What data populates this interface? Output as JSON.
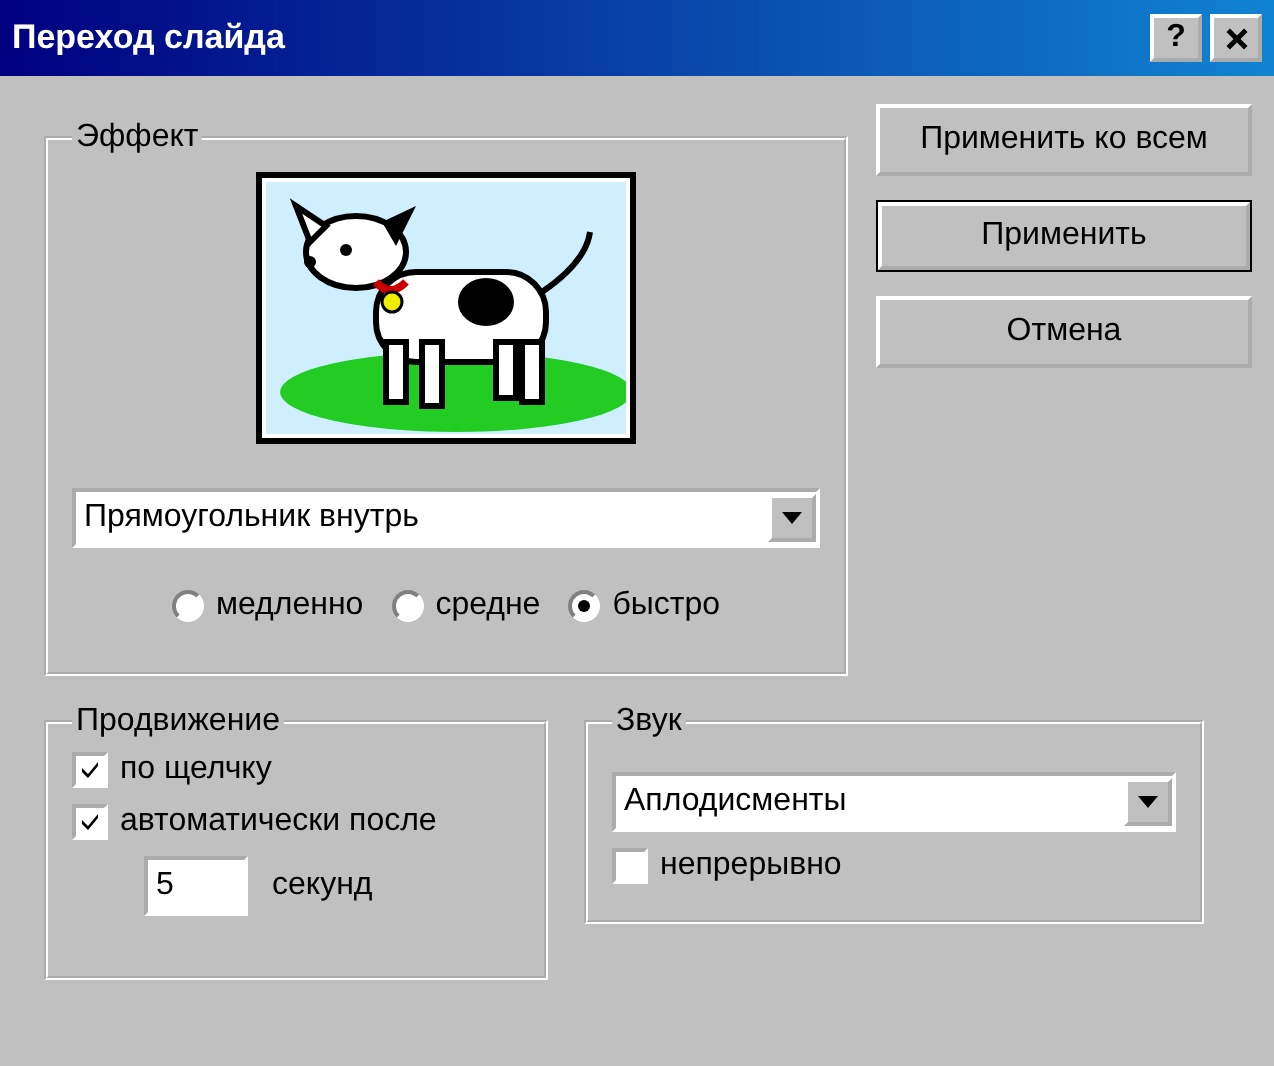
{
  "window": {
    "title": "Переход слайда",
    "help": "?"
  },
  "effect": {
    "label": "Эффект",
    "transition": "Прямоугольник внутрь",
    "speeds": [
      {
        "label": "медленно",
        "selected": false
      },
      {
        "label": "средне",
        "selected": false
      },
      {
        "label": "быстро",
        "selected": true
      }
    ]
  },
  "buttons": [
    {
      "label": "Применить ко всем",
      "default": false
    },
    {
      "label": "Применить",
      "default": true
    },
    {
      "label": "Отмена",
      "default": false
    }
  ],
  "advance": {
    "label": "Продвижение",
    "options": [
      {
        "label": "по щелчку",
        "checked": true
      },
      {
        "label": "автоматически после",
        "checked": true
      }
    ],
    "seconds": "5",
    "unit": "секунд"
  },
  "sound": {
    "label": "Звук",
    "value": "Аплодисменты",
    "loop": {
      "label": "непрерывно",
      "checked": false
    }
  }
}
